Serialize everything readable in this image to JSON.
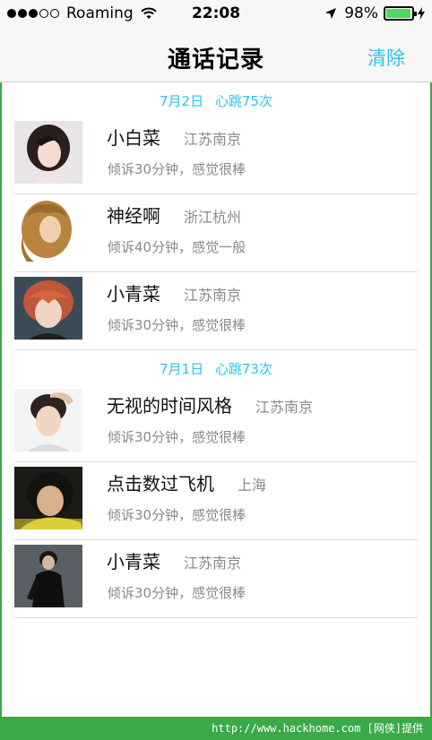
{
  "status_bar": {
    "carrier": "Roaming",
    "time": "22:08",
    "battery": "98%",
    "battery_level": 0.98
  },
  "nav": {
    "title": "通话记录",
    "clear_label": "清除"
  },
  "sections": [
    {
      "date": "7月2日",
      "heartbeat": "心跳75次",
      "rows": [
        {
          "name": "小白菜",
          "location": "江苏南京",
          "status": "倾诉30分钟，感觉很棒"
        },
        {
          "name": "神经啊",
          "location": "浙江杭州",
          "status": "倾诉40分钟，感觉一般"
        },
        {
          "name": "小青菜",
          "location": "江苏南京",
          "status": "倾诉30分钟，感觉很棒"
        }
      ]
    },
    {
      "date": "7月1日",
      "heartbeat": "心跳73次",
      "rows": [
        {
          "name": "无视的时间风格",
          "location": "江苏南京",
          "status": "倾诉30分钟，感觉很棒"
        },
        {
          "name": "点击数过飞机",
          "location": "上海",
          "status": "倾诉30分钟，感觉很棒"
        },
        {
          "name": "小青菜",
          "location": "江苏南京",
          "status": "倾诉30分钟，感觉很棒"
        }
      ]
    }
  ],
  "watermark": "http://www.hackhome.com [网侠]提供",
  "colors": {
    "accent": "#2ec3ea",
    "battery": "#4cd964",
    "frame": "#3aaa48"
  }
}
